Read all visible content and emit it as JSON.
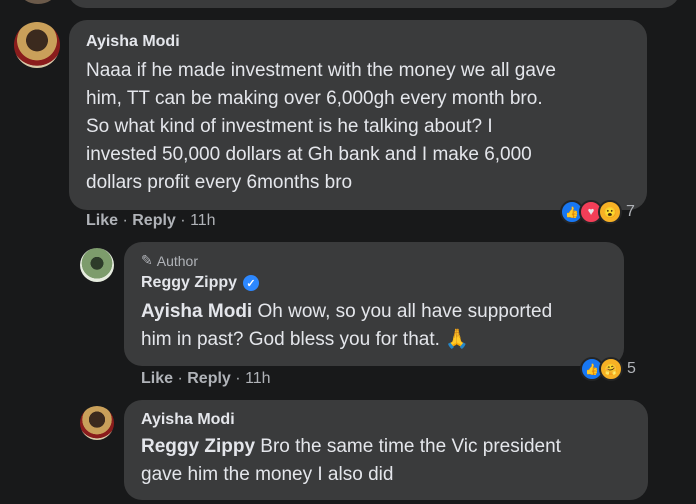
{
  "comments": [
    {
      "author": "Ayisha Modi",
      "lines": [
        "Naaa if he made investment with the money we all gave",
        "him, TT can be making over 6,000gh every month bro.",
        "So what kind of investment is he talking about? I",
        "invested 50,000 dollars at Gh bank and I make 6,000",
        "dollars profit every 6months bro"
      ],
      "like_label": "Like",
      "reply_label": "Reply",
      "time": "11h",
      "reaction_count": "7",
      "reaction_icons": [
        "like-icon",
        "love-icon",
        "wow-icon"
      ]
    },
    {
      "badge": "Author",
      "author": "Reggy Zippy",
      "verified": true,
      "mention": "Ayisha Modi",
      "line1": "Oh wow, so you all have supported",
      "line2": "him in past? God bless you for that.",
      "emoji": "🙏",
      "like_label": "Like",
      "reply_label": "Reply",
      "time": "11h",
      "reaction_count": "5",
      "reaction_icons": [
        "like-icon",
        "care-icon"
      ]
    },
    {
      "author": "Ayisha Modi",
      "mention": "Reggy Zippy",
      "line1": "Bro the same time the Vic president",
      "line2": "gave him the money I also did"
    }
  ]
}
